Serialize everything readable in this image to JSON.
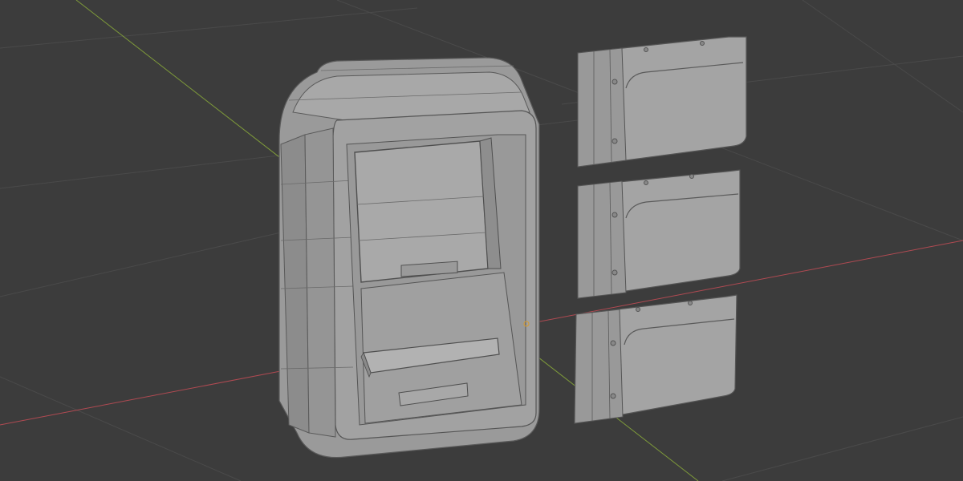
{
  "viewport": {
    "background_color": "#3c3c3c",
    "grid_line_color": "#4a4a4a",
    "axis_x_color": "#b04a52",
    "axis_y_color": "#7e9a3a",
    "mesh_color": "#9c9c9c",
    "mesh_shadow_color": "#7e7e7e",
    "wire_color": "#5a5a5a"
  },
  "scene_objects": [
    {
      "name": "atm-kiosk-body",
      "kind": "mesh"
    },
    {
      "name": "wall-panel-1",
      "kind": "mesh"
    },
    {
      "name": "wall-panel-2",
      "kind": "mesh"
    },
    {
      "name": "wall-panel-3",
      "kind": "mesh"
    }
  ]
}
